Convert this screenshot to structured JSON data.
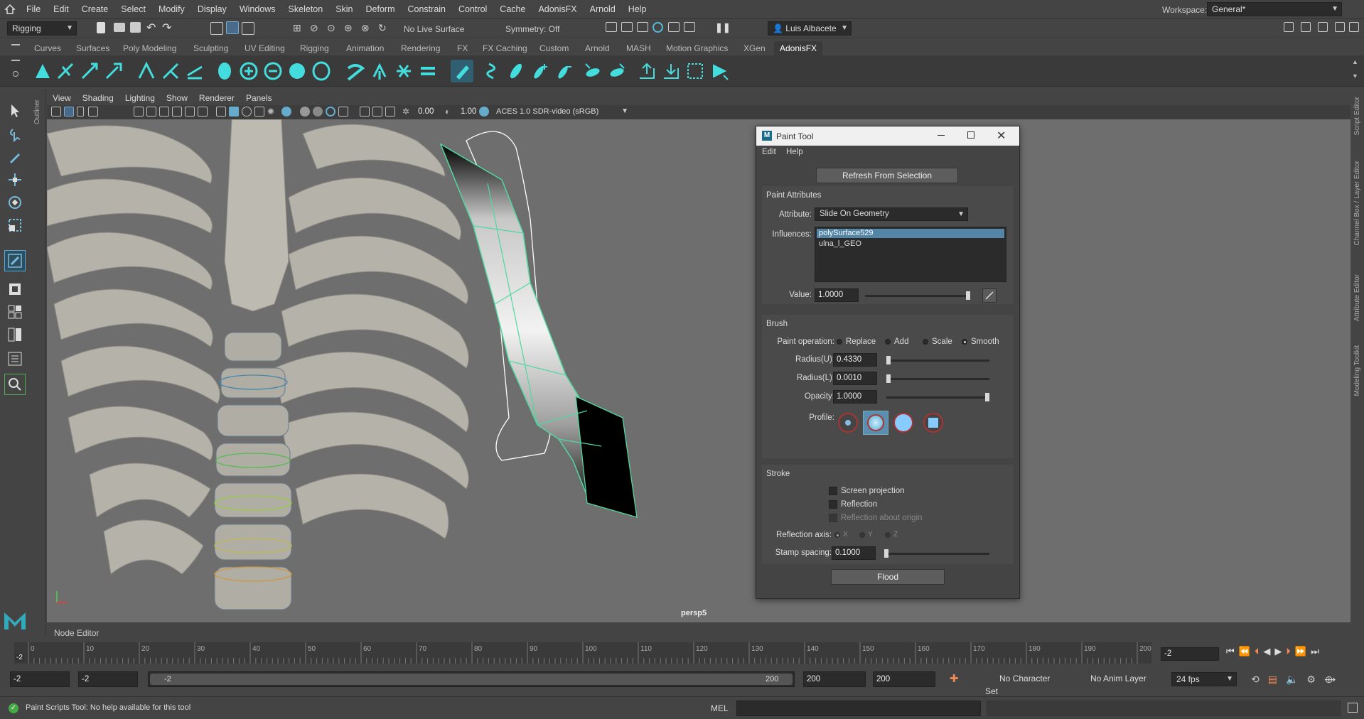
{
  "menubar": {
    "items": [
      "File",
      "Edit",
      "Create",
      "Select",
      "Modify",
      "Display",
      "Windows",
      "Skeleton",
      "Skin",
      "Deform",
      "Constrain",
      "Control",
      "Cache",
      "AdonisFX",
      "Arnold",
      "Help"
    ],
    "workspace_label": "Workspace:",
    "workspace_value": "General*"
  },
  "statusline": {
    "mode": "Rigging",
    "live_surface": "No Live Surface",
    "symmetry": "Symmetry: Off",
    "user": "Luis Albacete"
  },
  "shelf": {
    "tabs": [
      "Curves",
      "Surfaces",
      "Poly Modeling",
      "Sculpting",
      "UV Editing",
      "Rigging",
      "Animation",
      "Rendering",
      "FX",
      "FX Caching",
      "Custom",
      "Arnold",
      "MASH",
      "Motion Graphics",
      "XGen",
      "AdonisFX"
    ],
    "active_tab": "AdonisFX"
  },
  "outliner_label": "Outliner",
  "viewport": {
    "menu": [
      "View",
      "Shading",
      "Lighting",
      "Show",
      "Renderer",
      "Panels"
    ],
    "near_value": "0.00",
    "far_value": "1.00",
    "color_space": "ACES 1.0 SDR-video (sRGB)",
    "camera_label": "persp5"
  },
  "right_strip": [
    "Script Editor",
    "Channel Box / Layer Editor",
    "Attribute Editor",
    "Modeling Toolkit"
  ],
  "paint_tool": {
    "title": "Paint Tool",
    "menu": [
      "Edit",
      "Help"
    ],
    "refresh_button": "Refresh From Selection",
    "paint_attributes_header": "Paint Attributes",
    "attribute_label": "Attribute:",
    "attribute_value": "Slide On Geometry",
    "influences_label": "Influences:",
    "influences": [
      "polySurface529",
      "ulna_l_GEO"
    ],
    "value_label": "Value:",
    "value": "1.0000",
    "value_level": 1.0,
    "brush_header": "Brush",
    "paint_operation_label": "Paint operation:",
    "paint_operations": [
      "Replace",
      "Add",
      "Scale",
      "Smooth"
    ],
    "paint_operation_selected": "Smooth",
    "radius_u_label": "Radius(U):",
    "radius_u": "0.4330",
    "radius_l_label": "Radius(L):",
    "radius_l": "0.0010",
    "opacity_label": "Opacity:",
    "opacity": "1.0000",
    "opacity_level": 1.0,
    "profile_label": "Profile:",
    "stroke_header": "Stroke",
    "screen_projection": "Screen projection",
    "reflection": "Reflection",
    "reflection_origin": "Reflection about origin",
    "reflection_axis_label": "Reflection axis:",
    "axes": [
      "X",
      "Y",
      "Z"
    ],
    "stamp_spacing_label": "Stamp spacing:",
    "stamp_spacing": "0.1000",
    "flood_button": "Flood"
  },
  "node_editor_label": "Node Editor",
  "timeline": {
    "ticks": [
      "0",
      "10",
      "20",
      "30",
      "40",
      "50",
      "60",
      "70",
      "80",
      "90",
      "100",
      "110",
      "120",
      "130",
      "140",
      "150",
      "160",
      "170",
      "180",
      "190",
      "200"
    ],
    "current_frame_marker": "-2",
    "current_frame": "-2"
  },
  "range": {
    "start": "-2",
    "anim_start": "-2",
    "slider_start": "-2",
    "slider_end": "200",
    "anim_end": "200",
    "end": "200",
    "character_set": "No Character Set",
    "anim_layer": "No Anim Layer",
    "fps": "24 fps"
  },
  "helpline": {
    "message": "Paint Scripts Tool: No help available for this tool",
    "cmd_type": "MEL"
  }
}
